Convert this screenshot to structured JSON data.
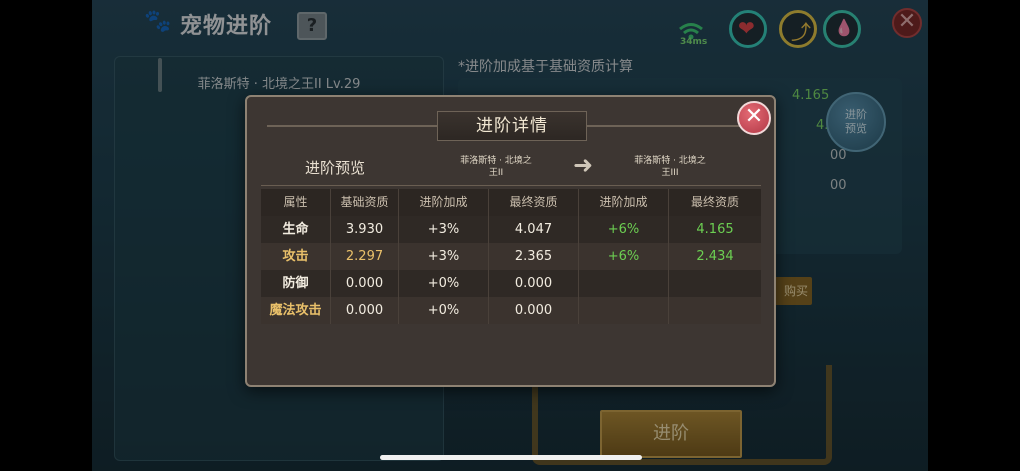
{
  "screen": {
    "title": "宠物进阶",
    "help_label": "?",
    "pet_label": "菲洛斯特 · 北境之王II Lv.29",
    "note": "*进阶加成基于基础资质计算",
    "preview_button": "进阶\n预览",
    "buy_button": "购买",
    "advance_button": "进阶",
    "ping": "34ms",
    "close_symbol": "✕",
    "peek_values": [
      "4.165",
      "4.34",
      "00",
      "00"
    ]
  },
  "dialog": {
    "title": "进阶详情",
    "close_symbol": "✕",
    "preview_label": "进阶预览",
    "pet_from": "菲洛斯特 · 北境之\n王II",
    "pet_to": "菲洛斯特 · 北境之\n王III",
    "headers": [
      "属性",
      "基础资质",
      "进阶加成",
      "最终资质",
      "进阶加成",
      "最终资质"
    ],
    "rows": [
      {
        "attr": "生命",
        "base": "3.930",
        "bonus_now": "+3%",
        "final_now": "4.047",
        "bonus_next": "+6%",
        "final_next": "4.165"
      },
      {
        "attr": "攻击",
        "base": "2.297",
        "bonus_now": "+3%",
        "final_now": "2.365",
        "bonus_next": "+6%",
        "final_next": "2.434"
      },
      {
        "attr": "防御",
        "base": "0.000",
        "bonus_now": "+0%",
        "final_now": "0.000",
        "bonus_next": "",
        "final_next": ""
      },
      {
        "attr": "魔法攻击",
        "base": "0.000",
        "bonus_now": "+0%",
        "final_now": "0.000",
        "bonus_next": "",
        "final_next": ""
      }
    ]
  },
  "colors": {
    "accent_gold": "#c9a24f",
    "positive_green": "#6ccf52",
    "attr_orange": "#e9c06a"
  }
}
